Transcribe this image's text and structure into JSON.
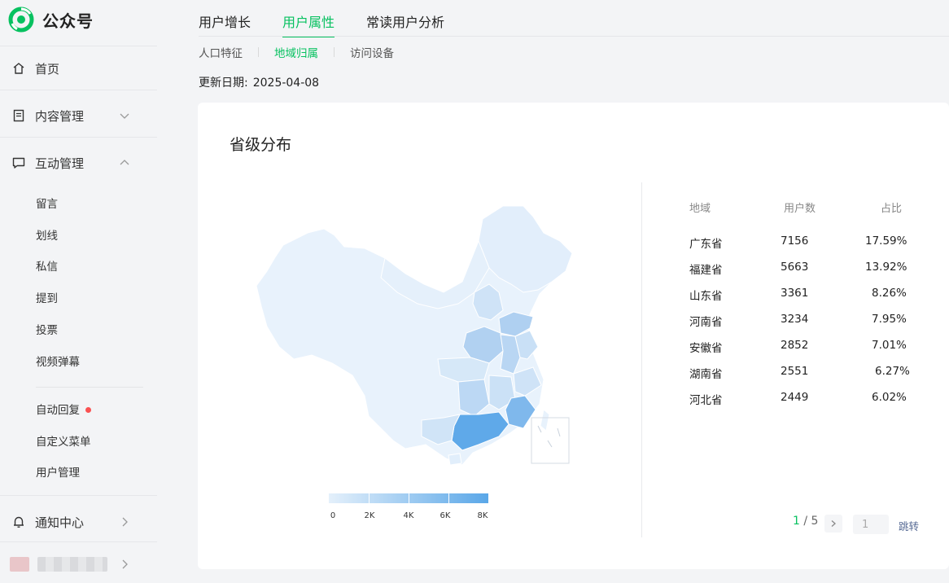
{
  "brand": {
    "name": "公众号"
  },
  "sidebar": {
    "home": "首页",
    "content": "内容管理",
    "interaction": "互动管理",
    "sub_items": [
      "留言",
      "划线",
      "私信",
      "提到",
      "投票",
      "视频弹幕"
    ],
    "auto_reply": "自动回复",
    "custom_menu": "自定义菜单",
    "user_mgmt": "用户管理",
    "notifications": "通知中心"
  },
  "tabs": [
    "用户增长",
    "用户属性",
    "常读用户分析"
  ],
  "subtabs": [
    "人口特征",
    "地域归属",
    "访问设备"
  ],
  "update": {
    "label": "更新日期:",
    "date": "2025-04-08"
  },
  "card": {
    "title": "省级分布"
  },
  "legend": {
    "labels": [
      "0",
      "2K",
      "4K",
      "6K",
      "8K"
    ]
  },
  "table": {
    "headers": [
      "地域",
      "用户数",
      "占比"
    ],
    "rows": [
      {
        "region": "广东省",
        "users": "7156",
        "pct": "17.59%"
      },
      {
        "region": "福建省",
        "users": "5663",
        "pct": "13.92%"
      },
      {
        "region": "山东省",
        "users": "3361",
        "pct": "8.26%"
      },
      {
        "region": "河南省",
        "users": "3234",
        "pct": "7.95%"
      },
      {
        "region": "安徽省",
        "users": "2852",
        "pct": "7.01%"
      },
      {
        "region": "湖南省",
        "users": "2551",
        "pct": "6.27%"
      },
      {
        "region": "河北省",
        "users": "2449",
        "pct": "6.02%"
      }
    ]
  },
  "pager": {
    "current": "1",
    "total": "/ 5",
    "input": "1",
    "jump": "跳转"
  },
  "colors": {
    "accent": "#07c160",
    "map_light": "#e4f0fb",
    "map_dark": "#5aa7e8",
    "red_dot": "#fa5151"
  }
}
